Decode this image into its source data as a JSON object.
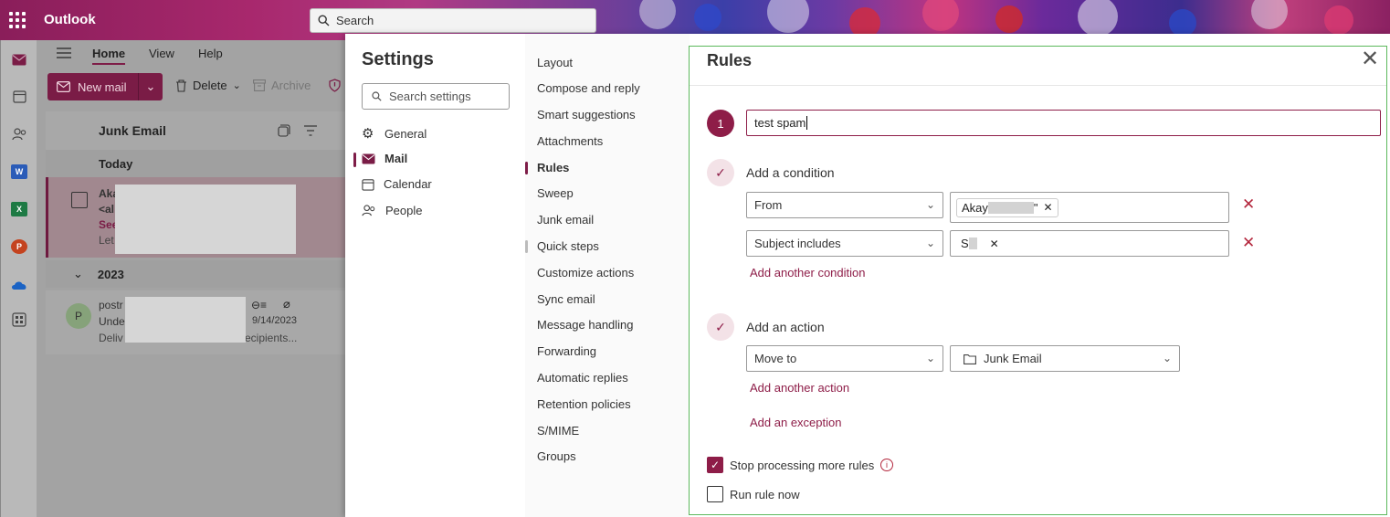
{
  "app": {
    "name": "Outlook",
    "search_placeholder": "Search"
  },
  "rail": {
    "icons": [
      "mail-icon",
      "calendar-icon",
      "people-icon",
      "word-icon",
      "excel-icon",
      "powerpoint-icon",
      "onedrive-icon",
      "apps-icon"
    ]
  },
  "ribbon": {
    "tabs": [
      "Home",
      "View",
      "Help"
    ],
    "new_mail": "New mail",
    "delete": "Delete",
    "archive": "Archive"
  },
  "mail_list": {
    "folder": "Junk Email",
    "groups": [
      "Today",
      "2023"
    ],
    "messages": [
      {
        "sender": "Aka",
        "line2": "<al",
        "line3": "See",
        "preview": "Let"
      },
      {
        "avatar": "P",
        "sender": "postr",
        "subject": "Unde",
        "preview": "Deliv",
        "preview_end": "ecipients...",
        "date": "9/14/2023"
      }
    ]
  },
  "settings": {
    "title": "Settings",
    "search_placeholder": "Search settings",
    "categories": [
      {
        "label": "General",
        "icon": "gear-icon"
      },
      {
        "label": "Mail",
        "icon": "mail-icon"
      },
      {
        "label": "Calendar",
        "icon": "calendar-icon"
      },
      {
        "label": "People",
        "icon": "people-icon"
      }
    ],
    "mail_sections": [
      "Layout",
      "Compose and reply",
      "Smart suggestions",
      "Attachments",
      "Rules",
      "Sweep",
      "Junk email",
      "Quick steps",
      "Customize actions",
      "Sync email",
      "Message handling",
      "Forwarding",
      "Automatic replies",
      "Retention policies",
      "S/MIME",
      "Groups"
    ]
  },
  "rules": {
    "title": "Rules",
    "step_number": "1",
    "rule_name": "test spam",
    "condition_heading": "Add a condition",
    "conditions": [
      {
        "field": "From",
        "value": "Akay",
        "value_tail": "\""
      },
      {
        "field": "Subject includes",
        "value": "S"
      }
    ],
    "add_condition": "Add another condition",
    "action_heading": "Add an action",
    "action": {
      "type": "Move to",
      "folder": "Junk Email"
    },
    "add_action": "Add another action",
    "add_exception": "Add an exception",
    "stop_processing": {
      "label": "Stop processing more rules",
      "checked": true
    },
    "run_now": {
      "label": "Run rule now",
      "checked": false
    }
  },
  "colors": {
    "accent": "#8e1d48",
    "remove": "#b3263c",
    "panel_border": "#5cb85c"
  }
}
